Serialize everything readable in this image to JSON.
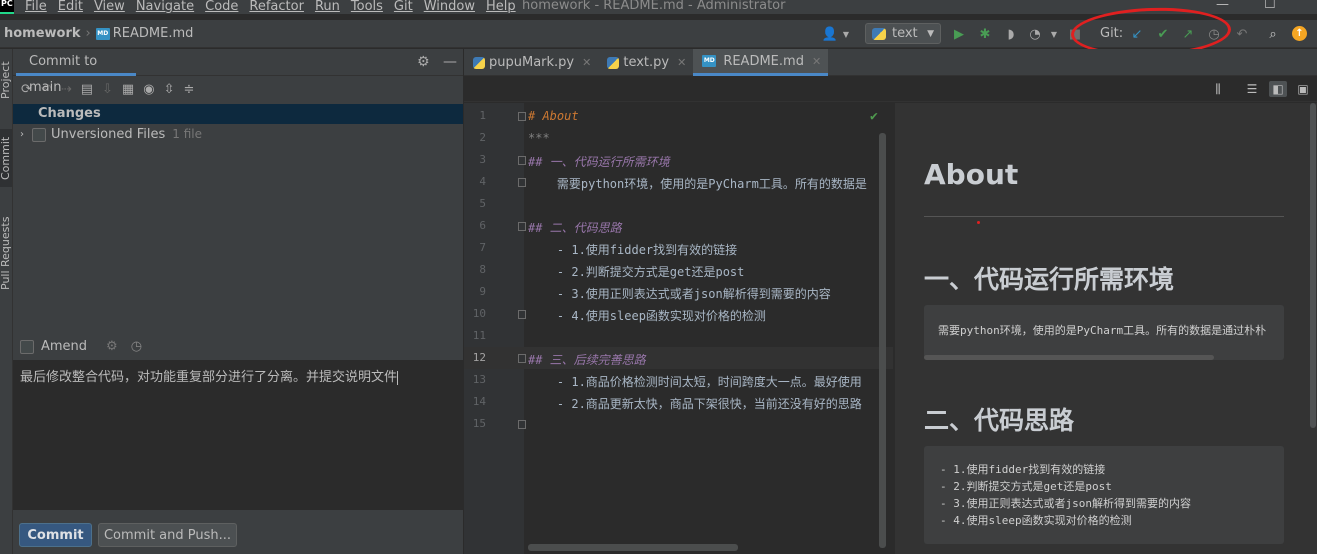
{
  "window": {
    "title": "homework - README.md - Administrator"
  },
  "menu": [
    "File",
    "Edit",
    "View",
    "Navigate",
    "Code",
    "Refactor",
    "Run",
    "Tools",
    "Git",
    "Window",
    "Help"
  ],
  "navbar": {
    "project": "homework",
    "file": "README.md",
    "md_badge": "MD",
    "run_config": "text",
    "git_label": "Git:"
  },
  "stripe": {
    "tabs": [
      "Project",
      "Commit",
      "Pull Requests"
    ]
  },
  "commit_panel": {
    "tab_label": "Commit to main",
    "changes_label": "Changes",
    "unversioned_label": "Unversioned Files",
    "unversioned_count": "1 file",
    "amend_label": "Amend",
    "message": "最后修改整合代码，对功能重复部分进行了分离。并提交说明文件",
    "commit_button": "Commit",
    "commit_push_button": "Commit and Push..."
  },
  "tabs": [
    {
      "label": "pupuMark.py",
      "icon": "python-file-icon",
      "active": false
    },
    {
      "label": "text.py",
      "icon": "python-file-icon",
      "active": false
    },
    {
      "label": "README.md",
      "icon": "markdown-file-icon",
      "active": true
    }
  ],
  "editor": {
    "line_numbers": [
      "1",
      "2",
      "3",
      "4",
      "5",
      "6",
      "7",
      "8",
      "9",
      "10",
      "11",
      "12",
      "13",
      "14",
      "15"
    ],
    "current_line": 12,
    "lines": [
      "# About",
      "***",
      "## 一、代码运行所需环境",
      "    需要python环境，使用的是PyCharm工具。所有的数据是",
      "",
      "## 二、代码思路",
      "    - 1.使用fidder找到有效的链接",
      "    - 2.判断提交方式是get还是post",
      "    - 3.使用正则表达式或者json解析得到需要的内容",
      "    - 4.使用sleep函数实现对价格的检测",
      "",
      "## 三、后续完善思路",
      "    - 1.商品价格检测时间太短，时间跨度大一点。最好使用",
      "    - 2.商品更新太快，商品下架很快，当前还没有好的思路",
      ""
    ]
  },
  "preview": {
    "h1": "About",
    "h2_1": "一、代码运行所需环境",
    "block1": "需要python环境，使用的是PyCharm工具。所有的数据是通过朴朴",
    "h2_2": "二、代码思路",
    "block2": [
      "- 1.使用fidder找到有效的链接",
      "- 2.判断提交方式是get还是post",
      "- 3.使用正则表达式或者json解析得到需要的内容",
      "- 4.使用sleep函数实现对价格的检测"
    ]
  },
  "colors": {
    "accent": "#4a88c7",
    "run_green": "#499c54",
    "annotation": "#e02020",
    "git_blue": "#3592c4"
  }
}
